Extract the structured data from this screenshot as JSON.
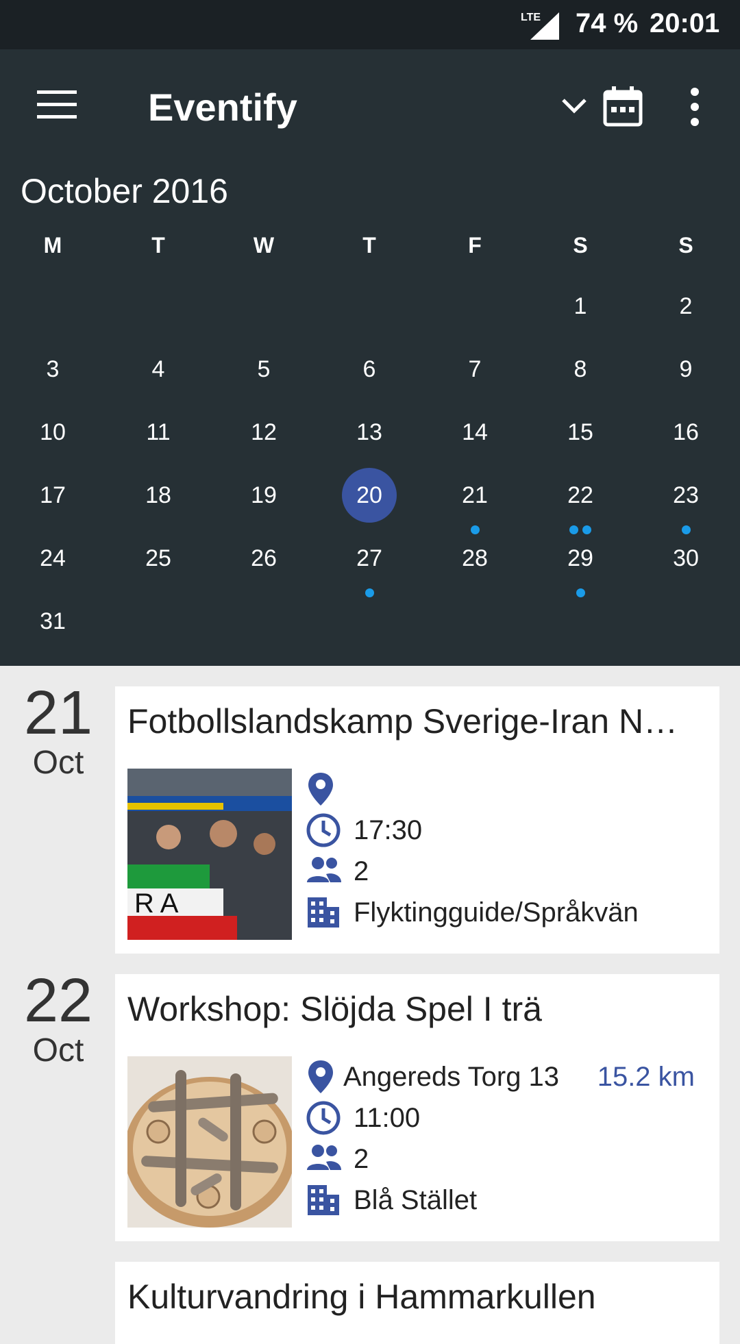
{
  "status_bar": {
    "network": "LTE",
    "battery": "74 %",
    "time": "20:01"
  },
  "app_bar": {
    "title": "Eventify"
  },
  "calendar": {
    "month_label": "October 2016",
    "weekdays": [
      "M",
      "T",
      "W",
      "T",
      "F",
      "S",
      "S"
    ],
    "selected_day": 20,
    "rows": [
      [
        null,
        null,
        null,
        null,
        null,
        1,
        2
      ],
      [
        3,
        4,
        5,
        6,
        7,
        8,
        9
      ],
      [
        10,
        11,
        12,
        13,
        14,
        15,
        16
      ],
      [
        17,
        18,
        19,
        20,
        21,
        22,
        23
      ],
      [
        24,
        25,
        26,
        27,
        28,
        29,
        30
      ],
      [
        31,
        null,
        null,
        null,
        null,
        null,
        null
      ]
    ],
    "event_dots": {
      "21": 1,
      "22": 2,
      "23": 1,
      "27": 1,
      "29": 1
    },
    "dot_color": "#1a9be8",
    "selected_color": "#3a54a1"
  },
  "events": [
    {
      "day": "21",
      "month": "Oct",
      "title": "Fotbollslandskamp Sverige-Iran N…",
      "location": "",
      "distance": "",
      "time": "17:30",
      "attendees": "2",
      "organizer": "Flyktingguide/Språkvän",
      "image": "football-fans-photo"
    },
    {
      "day": "22",
      "month": "Oct",
      "title": "Workshop: Slöjda Spel I trä",
      "location": "Angereds Torg 13",
      "distance": "15.2 km",
      "time": "11:00",
      "attendees": "2",
      "organizer": "Blå Stället",
      "image": "wooden-game-photo"
    },
    {
      "title": "Kulturvandring i Hammarkullen"
    }
  ],
  "colors": {
    "appbar": "#263035",
    "statusbar": "#1b2125",
    "accent": "#3a54a1",
    "icon": "#3a54a1"
  }
}
